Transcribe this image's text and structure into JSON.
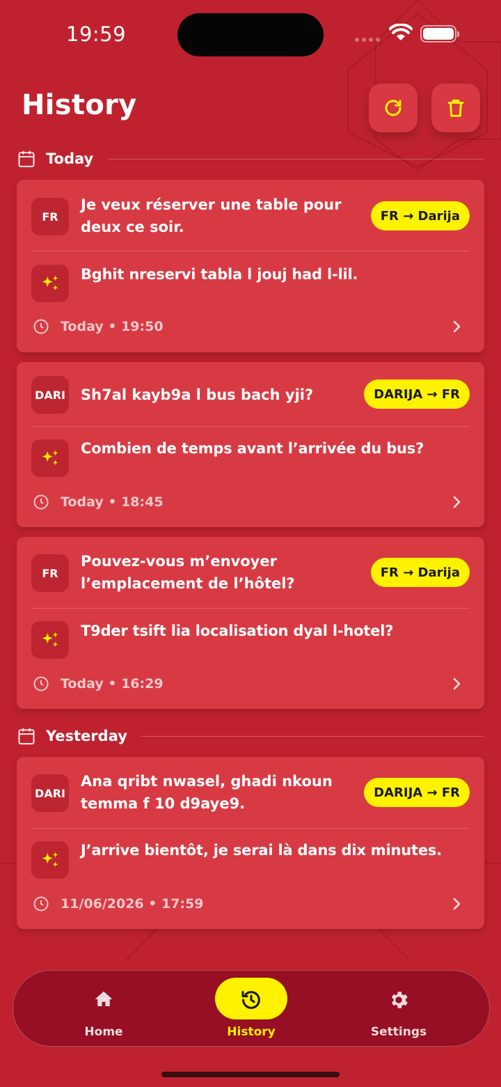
{
  "status": {
    "time": "19:59"
  },
  "header": {
    "title": "History",
    "refresh_icon": "refresh-icon",
    "delete_icon": "trash-icon"
  },
  "sections": [
    {
      "label": "Today"
    },
    {
      "label": "Yesterday"
    }
  ],
  "cards": [
    {
      "lang": "FR",
      "source": "Je veux réserver une table pour deux ce soir.",
      "pair": "FR → Darija",
      "translation": "Bghit nreservi tabla l jouj had l-lil.",
      "timestamp": "Today • 19:50"
    },
    {
      "lang": "DARI",
      "source": "Sh7al kayb9a l bus bach yji?",
      "pair": "DARIJA → FR",
      "translation": "Combien de temps avant l’arrivée du bus?",
      "timestamp": "Today • 18:45"
    },
    {
      "lang": "FR",
      "source": "Pouvez-vous m’envoyer l’emplacement de l’hôtel?",
      "pair": "FR → Darija",
      "translation": "T9der tsift lia localisation dyal l-hotel?",
      "timestamp": "Today • 16:29"
    },
    {
      "lang": "DARI",
      "source": "Ana qribt nwasel, ghadi nkoun temma f 10 d9aye9.",
      "pair": "DARIJA → FR",
      "translation": "J’arrive bientôt, je serai là dans dix minutes.",
      "timestamp": "11/06/2026 • 17:59"
    }
  ],
  "tabbar": {
    "tabs": [
      {
        "label": "Home",
        "icon": "home-icon"
      },
      {
        "label": "History",
        "icon": "history-icon",
        "active": true
      },
      {
        "label": "Settings",
        "icon": "gear-icon"
      }
    ]
  },
  "colors": {
    "background": "#bf222e",
    "card": "#d83a44",
    "accent": "#fff200",
    "tabbar": "#960f24"
  }
}
